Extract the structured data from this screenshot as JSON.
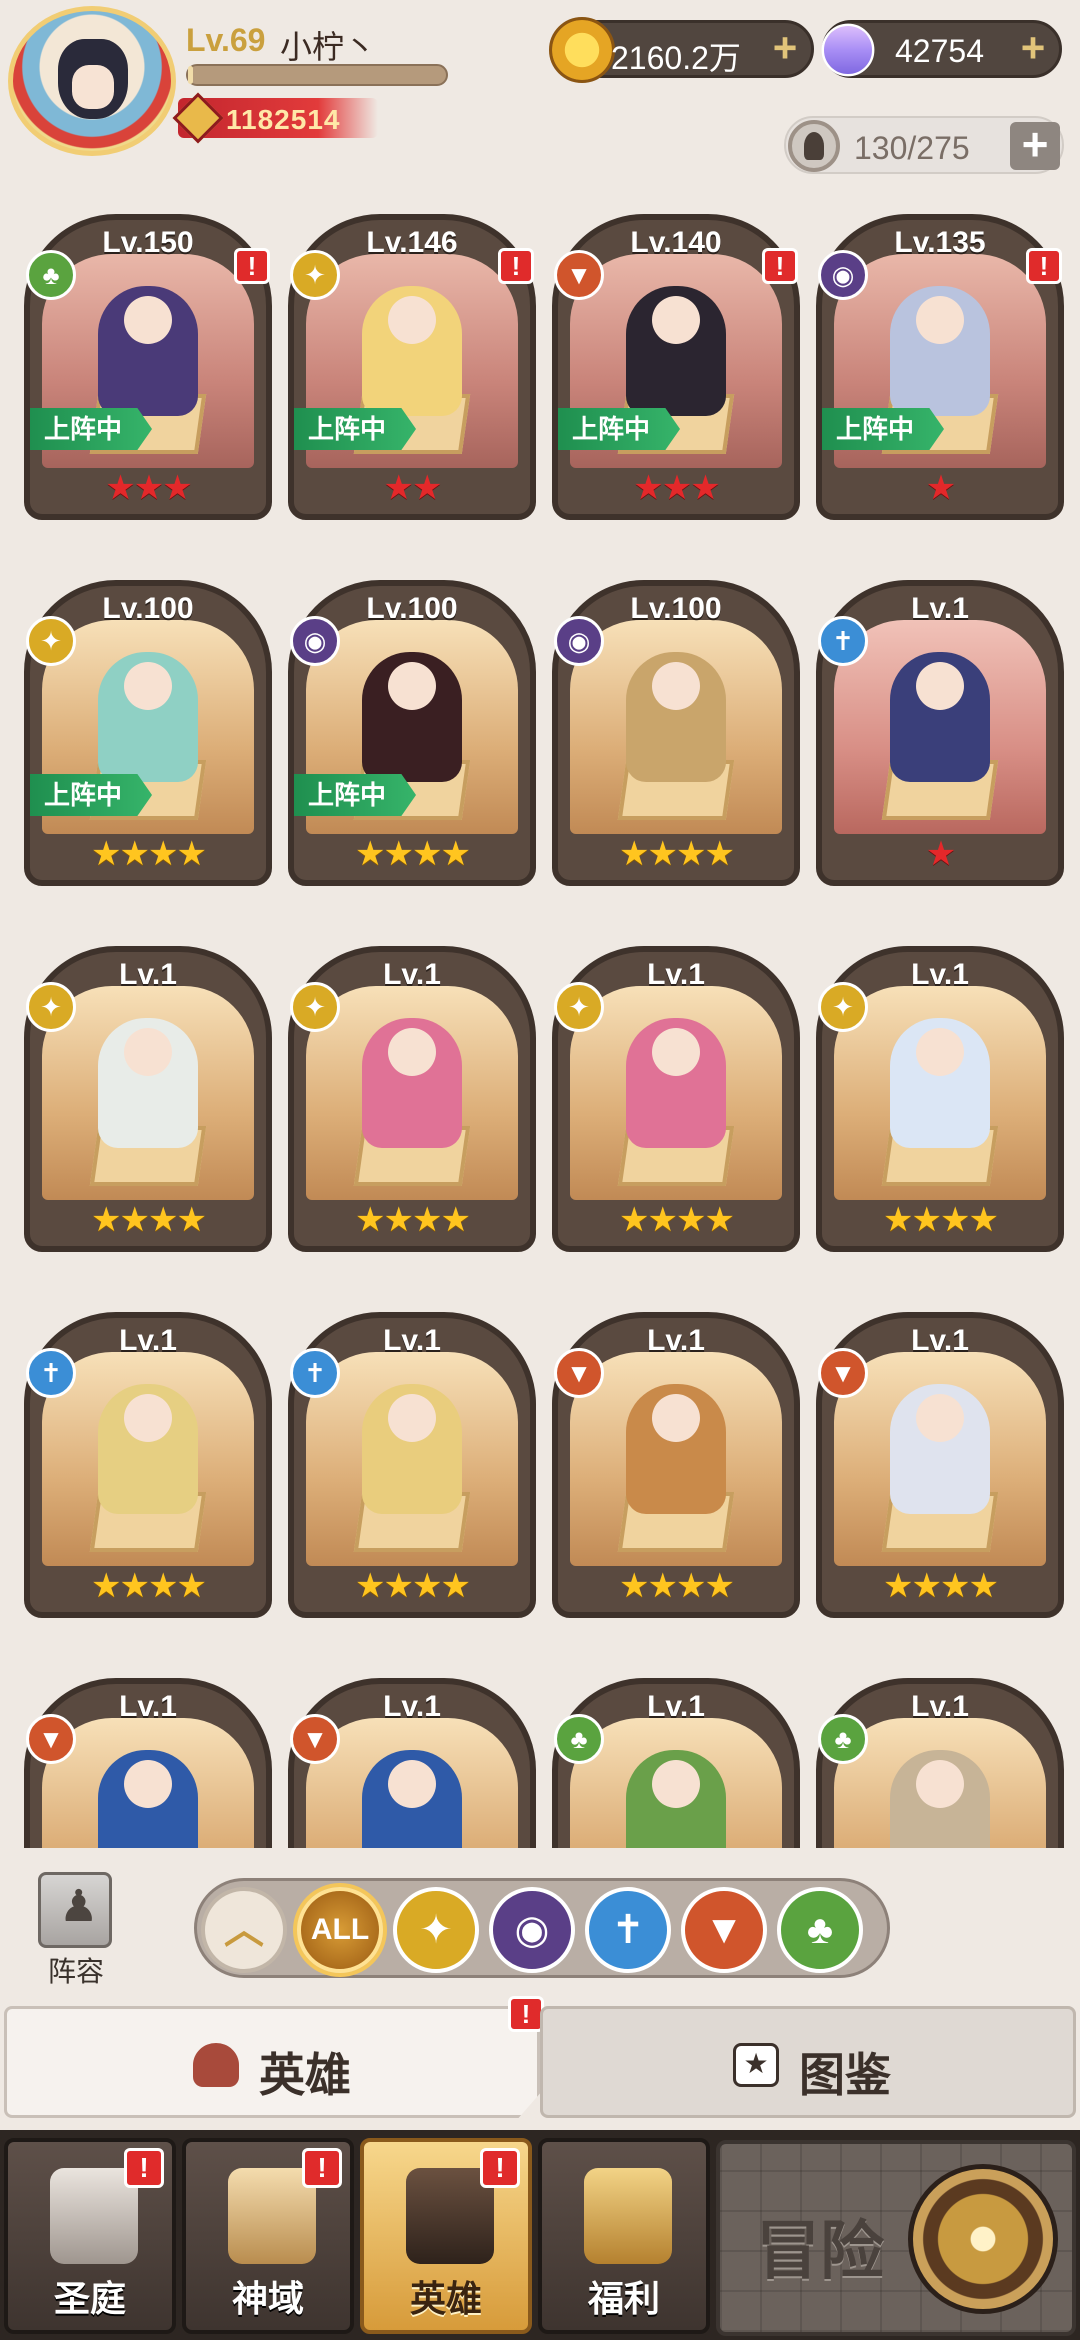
{
  "player": {
    "level": "Lv.69",
    "name": "小柠丶",
    "xp_progress": 0.02,
    "power": "1182514"
  },
  "currencies": {
    "gold": "2160.2万",
    "gems": "42754",
    "stamina": "130/275"
  },
  "heroes": [
    {
      "level": "Lv.150",
      "stars": "★★★",
      "star_color": "red",
      "faction": "nature",
      "deployed": "上阵中",
      "alert": "!"
    },
    {
      "level": "Lv.146",
      "stars": "★★",
      "star_color": "red",
      "faction": "light",
      "deployed": "上阵中",
      "alert": "!"
    },
    {
      "level": "Lv.140",
      "stars": "★★★",
      "star_color": "red",
      "faction": "beast",
      "deployed": "上阵中",
      "alert": "!"
    },
    {
      "level": "Lv.135",
      "stars": "★",
      "star_color": "red",
      "faction": "dark",
      "deployed": "上阵中",
      "alert": "!"
    },
    {
      "level": "Lv.100",
      "stars": "★★★★",
      "star_color": "gold",
      "faction": "light",
      "deployed": "上阵中",
      "alert": ""
    },
    {
      "level": "Lv.100",
      "stars": "★★★★",
      "star_color": "gold",
      "faction": "dark",
      "deployed": "上阵中",
      "alert": ""
    },
    {
      "level": "Lv.100",
      "stars": "★★★★",
      "star_color": "gold",
      "faction": "dark",
      "deployed": "",
      "alert": ""
    },
    {
      "level": "Lv.1",
      "stars": "★",
      "star_color": "red",
      "faction": "holy",
      "deployed": "",
      "alert": ""
    },
    {
      "level": "Lv.1",
      "stars": "★★★★",
      "star_color": "gold",
      "faction": "light",
      "deployed": "",
      "alert": ""
    },
    {
      "level": "Lv.1",
      "stars": "★★★★",
      "star_color": "gold",
      "faction": "light",
      "deployed": "",
      "alert": ""
    },
    {
      "level": "Lv.1",
      "stars": "★★★★",
      "star_color": "gold",
      "faction": "light",
      "deployed": "",
      "alert": ""
    },
    {
      "level": "Lv.1",
      "stars": "★★★★",
      "star_color": "gold",
      "faction": "light",
      "deployed": "",
      "alert": ""
    },
    {
      "level": "Lv.1",
      "stars": "★★★★",
      "star_color": "gold",
      "faction": "holy",
      "deployed": "",
      "alert": ""
    },
    {
      "level": "Lv.1",
      "stars": "★★★★",
      "star_color": "gold",
      "faction": "holy",
      "deployed": "",
      "alert": ""
    },
    {
      "level": "Lv.1",
      "stars": "★★★★",
      "star_color": "gold",
      "faction": "beast",
      "deployed": "",
      "alert": ""
    },
    {
      "level": "Lv.1",
      "stars": "★★★★",
      "star_color": "gold",
      "faction": "beast",
      "deployed": "",
      "alert": ""
    },
    {
      "level": "Lv.1",
      "stars": "",
      "star_color": "gold",
      "faction": "beast",
      "deployed": "",
      "alert": ""
    },
    {
      "level": "Lv.1",
      "stars": "",
      "star_color": "gold",
      "faction": "beast",
      "deployed": "",
      "alert": ""
    },
    {
      "level": "Lv.1",
      "stars": "",
      "star_color": "gold",
      "faction": "nature",
      "deployed": "",
      "alert": ""
    },
    {
      "level": "Lv.1",
      "stars": "",
      "star_color": "gold",
      "faction": "nature",
      "deployed": "",
      "alert": ""
    }
  ],
  "filters": {
    "lineup_label": "阵容",
    "all_label": "ALL",
    "items": [
      "sort-up",
      "all",
      "light",
      "dark",
      "holy",
      "beast",
      "nature"
    ]
  },
  "tabs": {
    "hero": "英雄",
    "codex": "图鉴",
    "hero_alert": "!"
  },
  "bottom_nav": {
    "items": [
      {
        "label": "圣庭",
        "alert": "!"
      },
      {
        "label": "神域",
        "alert": "!"
      },
      {
        "label": "英雄",
        "alert": "!"
      },
      {
        "label": "福利",
        "alert": ""
      }
    ],
    "adventure": "冒险"
  },
  "colors": {
    "background": "#efe9e3",
    "deployed_green": "#2aa35c",
    "alert_red": "#e02b2b",
    "star_gold": "#ffc51f",
    "star_red": "#e4282a"
  }
}
